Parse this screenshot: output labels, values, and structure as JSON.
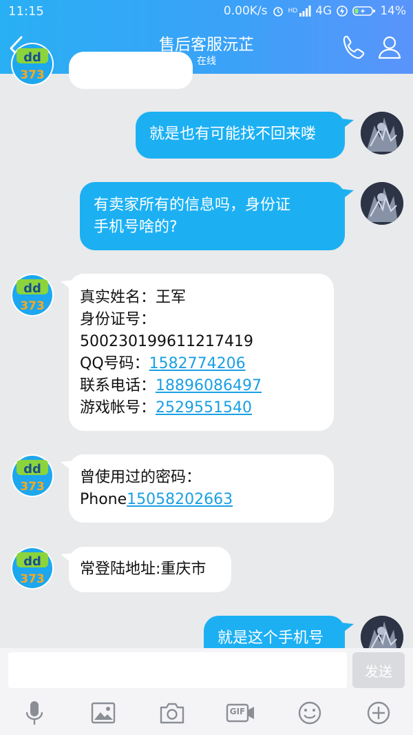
{
  "status_bar": {
    "time": "11:15",
    "net_speed": "0.00K/s",
    "hd_label": "HD",
    "network": "4G",
    "battery": "14%"
  },
  "header": {
    "title": "售后客服沅芷",
    "subtitle": "在线"
  },
  "messages": [
    {
      "side": "out",
      "lines": [
        "就是也有可能找不回来喽"
      ]
    },
    {
      "side": "out",
      "lines": [
        "有卖家所有的信息吗，身份证",
        "手机号啥的?"
      ]
    },
    {
      "side": "in",
      "rows": [
        {
          "label": "真实姓名：",
          "value": "王军",
          "link": false
        },
        {
          "label": "身份证号：",
          "value": "",
          "link": false
        },
        {
          "label": "500230199611217419",
          "value": "",
          "link": false
        },
        {
          "label": "QQ号码：",
          "value": "1582774206",
          "link": true
        },
        {
          "label": "联系电话：",
          "value": "18896086497",
          "link": true
        },
        {
          "label": "游戏帐号：",
          "value": "2529551540",
          "link": true
        }
      ]
    },
    {
      "side": "in",
      "rows": [
        {
          "label": "曾使用过的密码：",
          "value": "",
          "link": false
        },
        {
          "label": "Phone",
          "value": "15058202663",
          "link": true
        }
      ]
    },
    {
      "side": "in",
      "lines": [
        "常登陆地址:重庆市"
      ]
    },
    {
      "side": "out",
      "lines": [
        "就是这个手机号"
      ]
    }
  ],
  "input": {
    "placeholder": "",
    "send_label": "发送"
  },
  "toolbar": {
    "gif_label": "GIF"
  },
  "colors": {
    "accent": "#1cb0f3",
    "link": "#1a9fe3",
    "header_start": "#29aff3",
    "header_end": "#5a94fb"
  }
}
